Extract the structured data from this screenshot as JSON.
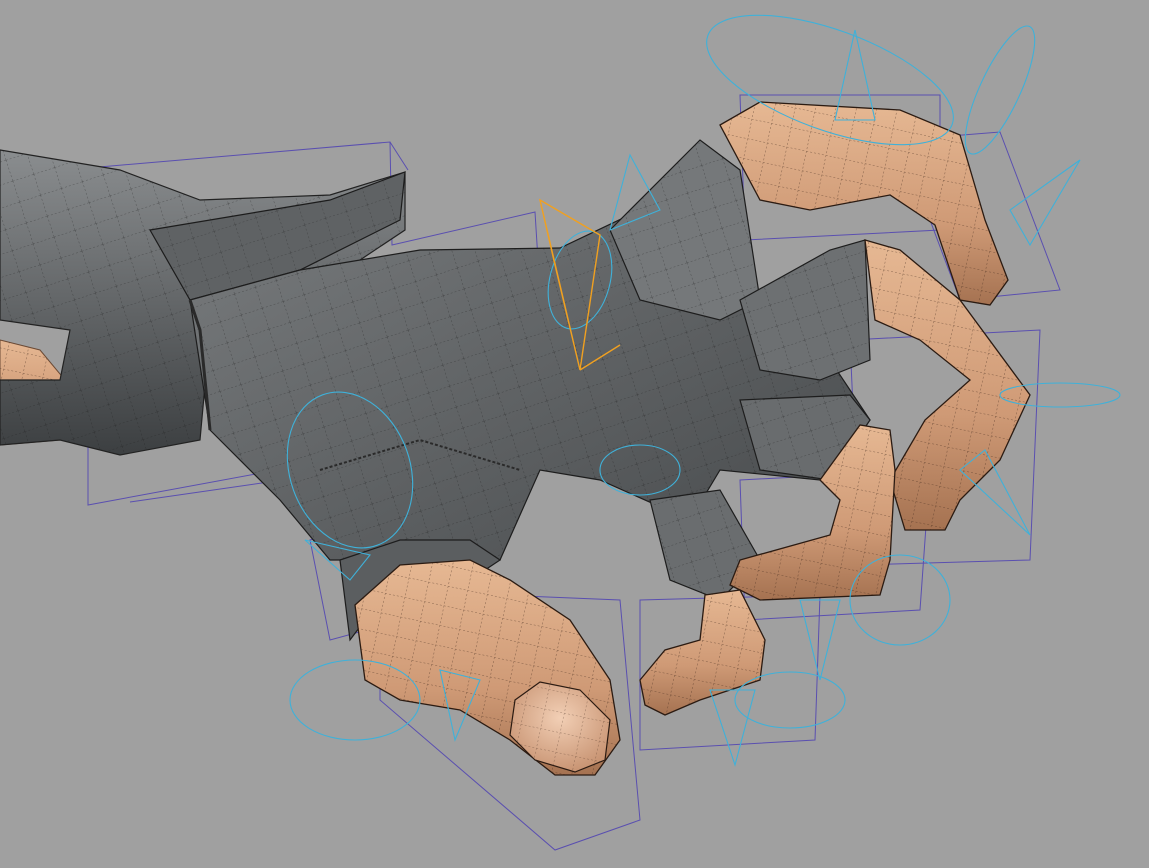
{
  "viewport": {
    "background_color": "#a0a0a0",
    "label": ""
  },
  "palette": {
    "glove": "#666a6c",
    "glove_light": "#8d9092",
    "glove_dark": "#3f4244",
    "skin": "#d6a27f",
    "skin_light": "#e9bf9e",
    "skin_dark": "#a97655",
    "control_box": "#5a4fb0",
    "control_curve": "#3fb1d9",
    "selected_joint": "#f0a020"
  },
  "icons": [
    "rig-control-icon",
    "joint-locator-icon"
  ]
}
